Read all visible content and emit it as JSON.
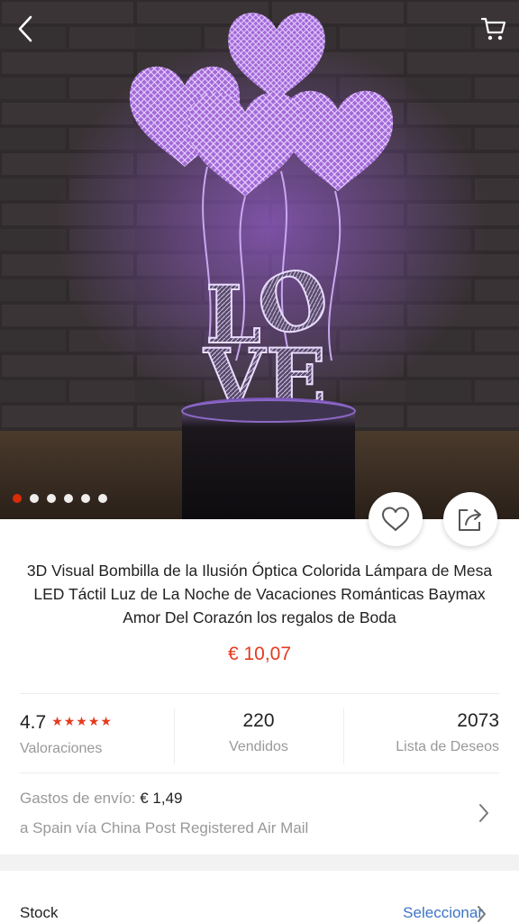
{
  "product": {
    "title": "3D Visual Bombilla de la Ilusión Óptica Colorida Lámpara de Mesa LED Táctil Luz de La Noche de Vacaciones Románticas Baymax Amor Del Corazón los regalos de Boda",
    "price": "€ 10,07",
    "image_text": "LOVE"
  },
  "gallery": {
    "dot_count": 6,
    "active_index": 0,
    "accent_color": "#e62e04"
  },
  "stats": {
    "rating": "4.7",
    "rating_value": 4.7,
    "stars_glyph": "★★★★★",
    "rating_label": "Valoraciones",
    "sold": "220",
    "sold_label": "Vendidos",
    "wishlist": "2073",
    "wishlist_label": "Lista de Deseos"
  },
  "shipping": {
    "label": "Gastos de envío: ",
    "cost": "€ 1,49",
    "route": "a Spain vía China Post Registered Air Mail"
  },
  "stock": {
    "label": "Stock",
    "action": "Seleccionar"
  },
  "icons": {
    "back": "chevron-left-icon",
    "cart": "cart-icon",
    "favorite": "heart-outline-icon",
    "share": "share-icon"
  },
  "colors": {
    "price": "#e53a1e",
    "link": "#3d74c6"
  }
}
